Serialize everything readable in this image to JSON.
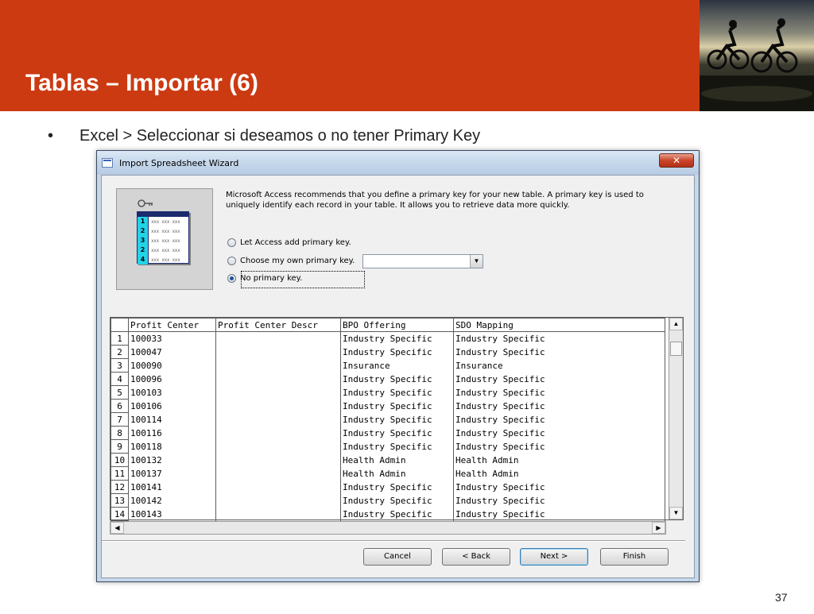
{
  "slide": {
    "title": "Tablas – Importar (6)",
    "bullet_symbol": "•",
    "bullet_text": "Excel > Seleccionar si deseamos o no tener Primary Key",
    "page_number": "37",
    "accent_color": "#cc3a12"
  },
  "dialog": {
    "title": "Import Spreadsheet Wizard",
    "close_label": "✕",
    "info_text": "Microsoft Access recommends that you define a primary key for your new table. A primary key is used to uniquely identify each record in your table. It allows you to retrieve data more quickly.",
    "illustration": {
      "row_numbers": [
        "1",
        "2",
        "3",
        "2",
        "4"
      ],
      "placeholder": "xxx xxx xxx"
    },
    "options": [
      {
        "label": "Let Access add primary key.",
        "checked": false
      },
      {
        "label": "Choose my own primary key.",
        "checked": false
      },
      {
        "label": "No primary key.",
        "checked": true
      }
    ],
    "primary_key_combo_value": "",
    "grid": {
      "columns": [
        "Profit Center",
        "Profit Center Descr",
        "BPO Offering",
        "SDO Mapping"
      ],
      "rows": [
        {
          "n": "1",
          "cells": [
            "100033",
            "",
            "Industry Specific",
            "Industry Specific"
          ]
        },
        {
          "n": "2",
          "cells": [
            "100047",
            "",
            "Industry Specific",
            "Industry Specific"
          ]
        },
        {
          "n": "3",
          "cells": [
            "100090",
            "",
            "Insurance",
            "Insurance"
          ]
        },
        {
          "n": "4",
          "cells": [
            "100096",
            "",
            "Industry Specific",
            "Industry Specific"
          ]
        },
        {
          "n": "5",
          "cells": [
            "100103",
            "",
            "Industry Specific",
            "Industry Specific"
          ]
        },
        {
          "n": "6",
          "cells": [
            "100106",
            "",
            "Industry Specific",
            "Industry Specific"
          ]
        },
        {
          "n": "7",
          "cells": [
            "100114",
            "",
            "Industry Specific",
            "Industry Specific"
          ]
        },
        {
          "n": "8",
          "cells": [
            "100116",
            "",
            "Industry Specific",
            "Industry Specific"
          ]
        },
        {
          "n": "9",
          "cells": [
            "100118",
            "",
            "Industry Specific",
            "Industry Specific"
          ]
        },
        {
          "n": "10",
          "cells": [
            "100132",
            "",
            "Health Admin",
            "Health Admin"
          ]
        },
        {
          "n": "11",
          "cells": [
            "100137",
            "",
            "Health Admin",
            "Health Admin"
          ]
        },
        {
          "n": "12",
          "cells": [
            "100141",
            "",
            "Industry Specific",
            "Industry Specific"
          ]
        },
        {
          "n": "13",
          "cells": [
            "100142",
            "",
            "Industry Specific",
            "Industry Specific"
          ]
        },
        {
          "n": "14",
          "cells": [
            "100143",
            "",
            "Industry Specific",
            "Industry Specific"
          ]
        }
      ]
    },
    "buttons": {
      "cancel": "Cancel",
      "back": "< Back",
      "next": "Next >",
      "finish": "Finish"
    }
  }
}
